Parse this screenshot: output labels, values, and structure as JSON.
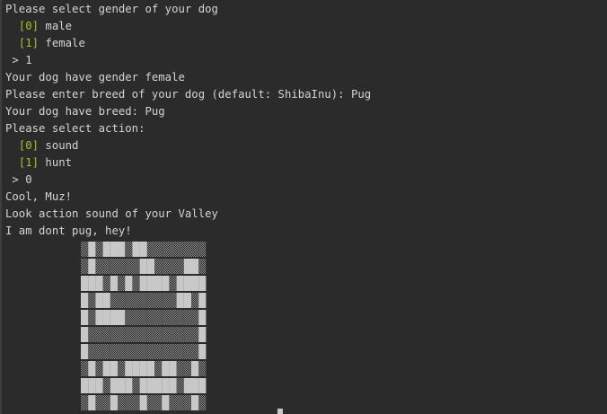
{
  "terminal": {
    "lines": [
      {
        "type": "text",
        "text": "Please select gender of your dog"
      },
      {
        "type": "option",
        "prefix": "  ",
        "index": "[0]",
        "label": " male"
      },
      {
        "type": "option",
        "prefix": "  ",
        "index": "[1]",
        "label": " female"
      },
      {
        "type": "text",
        "text": " > 1"
      },
      {
        "type": "text",
        "text": "Your dog have gender female"
      },
      {
        "type": "text",
        "text": "Please enter breed of your dog (default: ShibaInu): Pug"
      },
      {
        "type": "text",
        "text": "Your dog have breed: Pug"
      },
      {
        "type": "text",
        "text": "Please select action:"
      },
      {
        "type": "option",
        "prefix": "  ",
        "index": "[0]",
        "label": " sound"
      },
      {
        "type": "option",
        "prefix": "  ",
        "index": "[1]",
        "label": " hunt"
      },
      {
        "type": "text",
        "text": " > 0"
      },
      {
        "type": "text",
        "text": "Cool, Muz!"
      },
      {
        "type": "text",
        "text": "Look action sound of your Valley"
      },
      {
        "type": "text",
        "text": "I am dont pug, hey!"
      }
    ],
    "ascii_art": {
      "name": "pug-ascii-art",
      "grid_rows": [
        "░▓░▓▓▓░▓▓░░░░░░░░",
        "░▓░░░░░░▓▓░░░░▓▓░",
        "▓▓▓░▓░▓░▓▓▓▓░▓▓▓▓",
        "▓░▓▓░░░░░░░░░▓▓░▓",
        "▓░▓▓▓▓░░░░░░░░░░▓",
        "▓░░░░░░░░░░░░░░░▓",
        "▓░░░░░░░░░░░░░░░▓",
        "░▓░▓▓░▓▓▓▓░▓▓░░▓░",
        "▓▓▓░▓▓▓░▓▓▓▓▓░▓▓▓",
        "░▓░░▓░░░▓░░▓░░░▓░"
      ]
    },
    "colors": {
      "background": "#2b2b2b",
      "text": "#d4d4d4",
      "option_index": "#a8c023",
      "art_solid": "#c8c8c8",
      "art_shade": "#8a8a8a"
    }
  }
}
